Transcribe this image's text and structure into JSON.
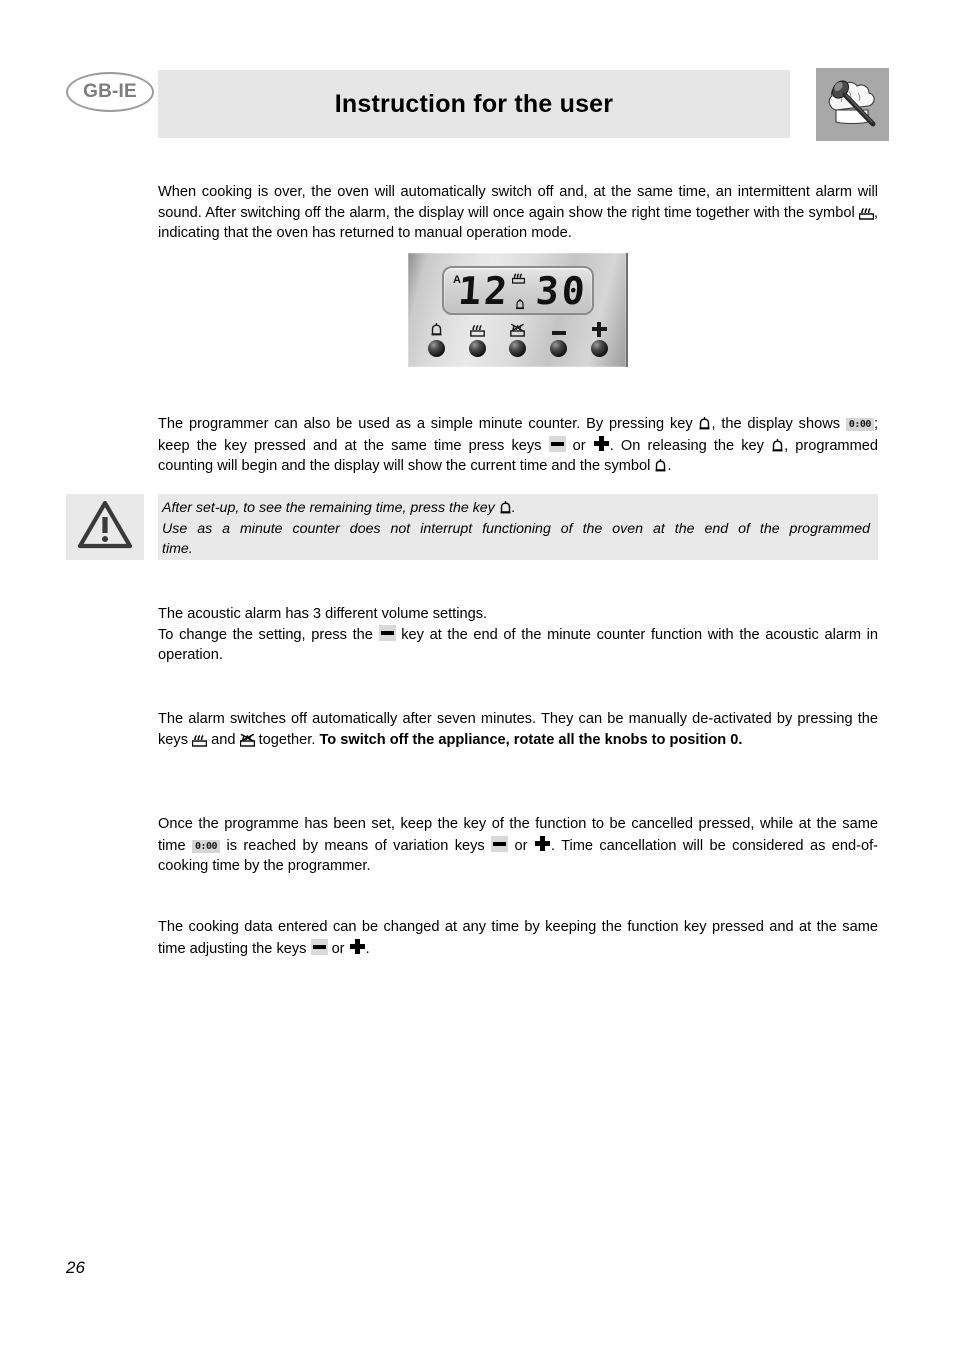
{
  "header": {
    "language_badge": "GB-IE",
    "title": "Instruction for the user",
    "logo_icon": "chef-hat-spoon-icon"
  },
  "paragraphs": {
    "p1_part1": "When cooking is over, the oven will automatically switch off and, at the same time, an intermittent alarm will sound. After switching off the alarm, the display will once again show the right time together with the symbol ",
    "p1_part2": ", indicating that the oven has returned to manual operation mode.",
    "p2_part1": "The programmer can also be used as a simple minute counter. By pressing key ",
    "p2_part2": ", the display shows ",
    "p2_lcd": "0:00",
    "p2_part3": "; keep the key pressed and at the same time press keys ",
    "p2_part4": " or ",
    "p2_part5": ". On releasing the key ",
    "p2_part6": ", programmed counting will begin and the display will show the current time and the symbol ",
    "p2_part7": ".",
    "p3_line1": "The acoustic alarm has 3 different volume settings.",
    "p3_part1": "To change the setting, press the ",
    "p3_part2": " key at the end of the minute counter function with the acoustic alarm in operation.",
    "p4_part1": "The alarm switches off automatically after seven minutes. They can be manually de-activated by pressing the keys ",
    "p4_part2": " and ",
    "p4_part3": " together. ",
    "p4_bold": "To switch off the appliance, rotate all the knobs to position 0.",
    "p5_part1": "Once the programme has been set, keep the key of the function to be cancelled pressed, while at the same time ",
    "p5_lcd": "0:00",
    "p5_part2": " is reached by means of variation keys ",
    "p5_part3": " or ",
    "p5_part4": ". Time cancellation will be considered as end-of-cooking time by the programmer.",
    "p6_part1": "The cooking data entered can be changed at any time by keeping the function key pressed and at the same time adjusting the keys ",
    "p6_part2": " or ",
    "p6_part3": "."
  },
  "warning": {
    "icon": "warning-triangle-icon",
    "line1_part1": "After set-up, to see the remaining time, press the key ",
    "line1_part2": ".",
    "line2": "Use as a minute counter does not interrupt functioning of the oven at the end of the programmed",
    "line3": "time."
  },
  "oven_panel": {
    "lcd": {
      "auto_indicator": "A",
      "time": "12 30",
      "oven_indicator_icon": "oven-heat-icon",
      "bell_indicator_icon": "bell-icon"
    },
    "buttons": [
      {
        "icon": "bell-icon",
        "name": "minute-counter-key"
      },
      {
        "icon": "oven-heat-icon",
        "name": "cooking-duration-key"
      },
      {
        "icon": "end-of-cooking-icon",
        "name": "end-of-cooking-key"
      },
      {
        "icon": "minus-icon",
        "name": "decrease-key"
      },
      {
        "icon": "plus-icon",
        "name": "increase-key"
      }
    ]
  },
  "footer": {
    "page_number": "26"
  }
}
